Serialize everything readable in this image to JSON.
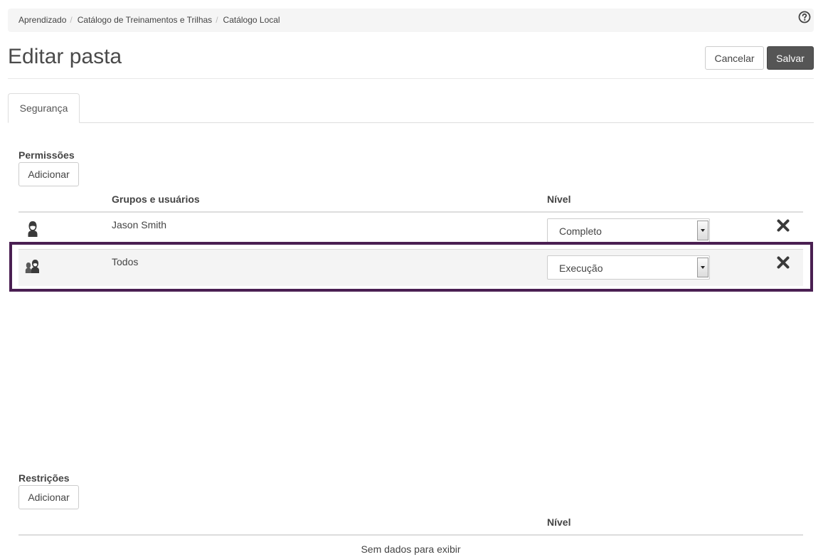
{
  "breadcrumb": {
    "items": [
      "Aprendizado",
      "Catálogo de Treinamentos e Trilhas",
      "Catálogo Local"
    ],
    "help_icon": "question-circle-icon"
  },
  "header": {
    "title": "Editar pasta",
    "cancel_label": "Cancelar",
    "save_label": "Salvar"
  },
  "tabs": [
    {
      "label": "Segurança",
      "active": true
    }
  ],
  "permissions": {
    "section_label": "Permissões",
    "add_label": "Adicionar",
    "columns": {
      "name": "Grupos e usuários",
      "level": "Nível"
    },
    "rows": [
      {
        "icon": "user-icon",
        "name": "Jason Smith",
        "level": "Completo",
        "remove_icon": "close-icon"
      },
      {
        "icon": "group-icon",
        "name": "Todos",
        "level": "Execução",
        "remove_icon": "close-icon",
        "highlighted": true
      }
    ]
  },
  "restrictions": {
    "section_label": "Restrições",
    "add_label": "Adicionar",
    "columns": {
      "level": "Nível"
    },
    "empty_text": "Sem dados para exibir"
  },
  "colors": {
    "save_button": "#555555",
    "highlight_border": "#4a1f52",
    "breadcrumb_bg": "#f5f5f5",
    "alt_row_bg": "#f4f4f4"
  }
}
